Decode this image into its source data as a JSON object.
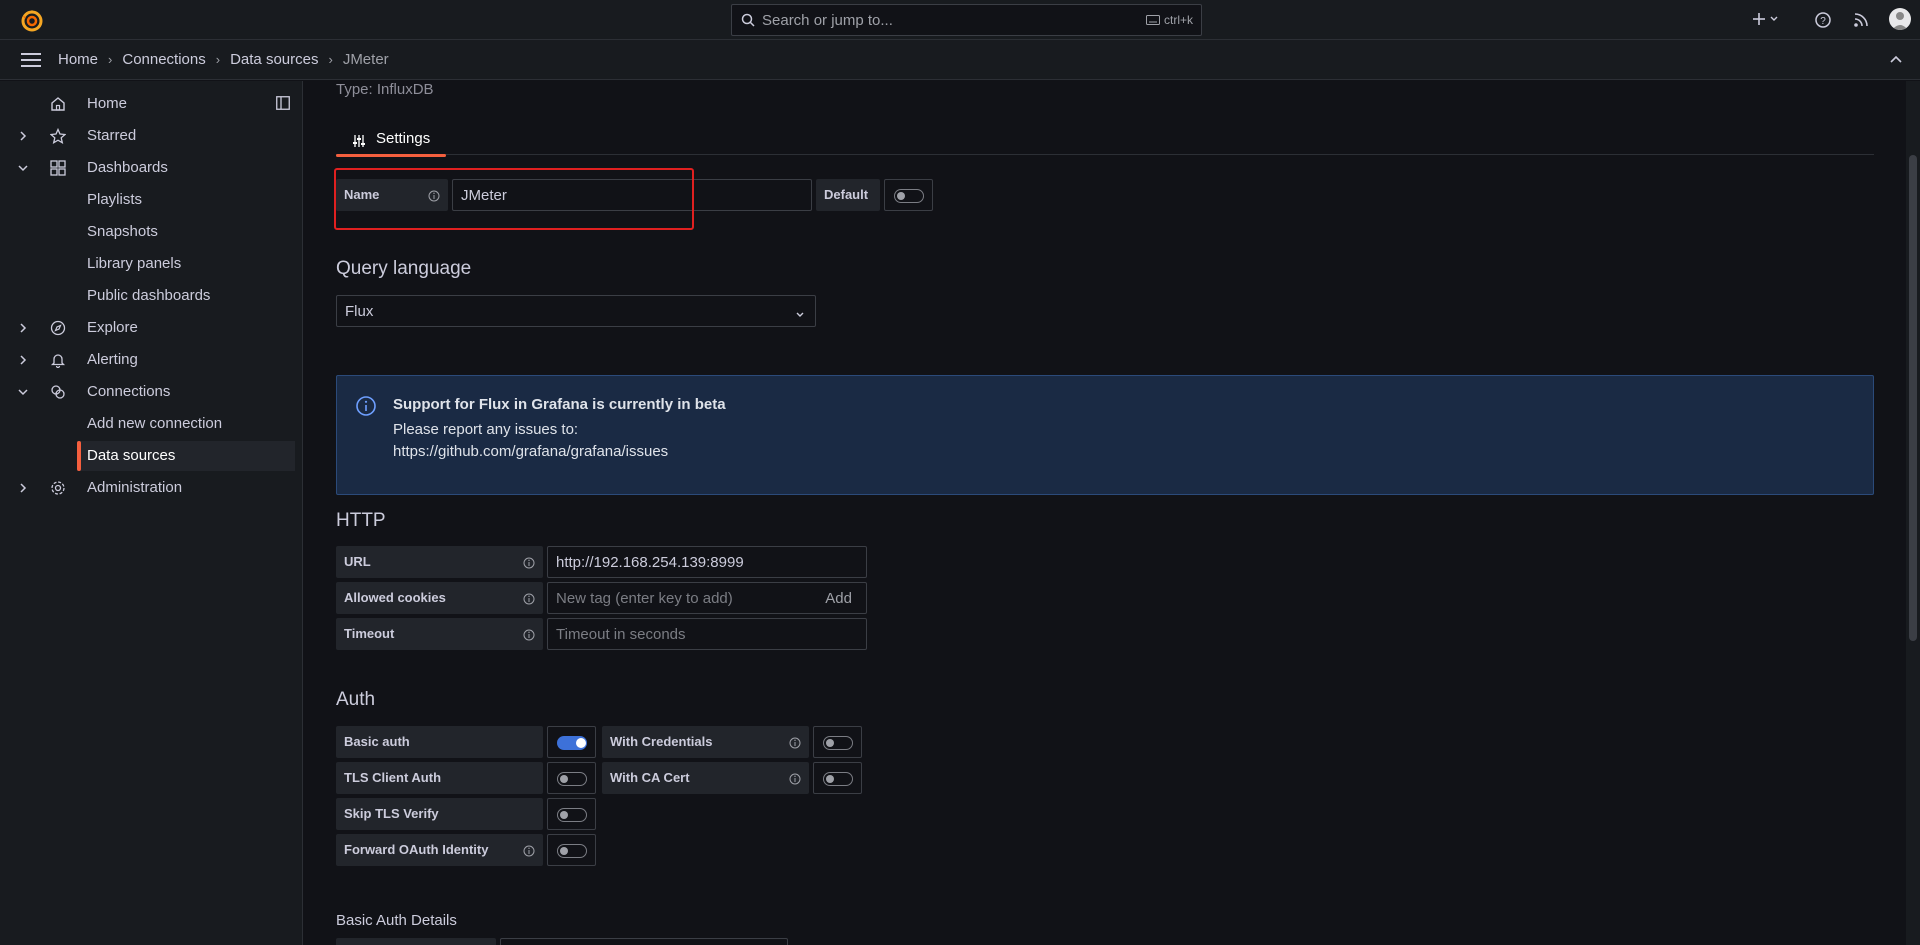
{
  "search": {
    "placeholder": "Search or jump to...",
    "shortcut": "ctrl+k"
  },
  "breadcrumb": [
    "Home",
    "Connections",
    "Data sources",
    "JMeter"
  ],
  "sidebar": {
    "items": [
      {
        "label": "Home"
      },
      {
        "label": "Starred"
      },
      {
        "label": "Dashboards"
      },
      {
        "label": "Playlists"
      },
      {
        "label": "Snapshots"
      },
      {
        "label": "Library panels"
      },
      {
        "label": "Public dashboards"
      },
      {
        "label": "Explore"
      },
      {
        "label": "Alerting"
      },
      {
        "label": "Connections"
      },
      {
        "label": "Add new connection"
      },
      {
        "label": "Data sources"
      },
      {
        "label": "Administration"
      }
    ]
  },
  "page": {
    "type_line": "Type: InfluxDB",
    "tab_settings": "Settings",
    "name_label": "Name",
    "name_value": "JMeter",
    "default_label": "Default",
    "default_on": false,
    "query_language_heading": "Query language",
    "query_language_value": "Flux",
    "alert": {
      "title": "Support for Flux in Grafana is currently in beta",
      "line1": "Please report any issues to:",
      "line2": "https://github.com/grafana/grafana/issues"
    },
    "http": {
      "heading": "HTTP",
      "url_label": "URL",
      "url_value": "http://192.168.254.139:8999",
      "cookies_label": "Allowed cookies",
      "cookies_placeholder": "New tag (enter key to add)",
      "cookies_add": "Add",
      "timeout_label": "Timeout",
      "timeout_placeholder": "Timeout in seconds"
    },
    "auth": {
      "heading": "Auth",
      "basic_auth": {
        "label": "Basic auth",
        "on": true
      },
      "with_credentials": {
        "label": "With Credentials",
        "on": false
      },
      "tls_client_auth": {
        "label": "TLS Client Auth",
        "on": false
      },
      "with_ca_cert": {
        "label": "With CA Cert",
        "on": false
      },
      "skip_tls_verify": {
        "label": "Skip TLS Verify",
        "on": false
      },
      "forward_oauth": {
        "label": "Forward OAuth Identity",
        "on": false
      }
    },
    "basic_auth_details_heading": "Basic Auth Details"
  },
  "colors": {
    "accent": "#f55f3e",
    "primary": "#3d71d9",
    "highlight": "#e02020"
  }
}
